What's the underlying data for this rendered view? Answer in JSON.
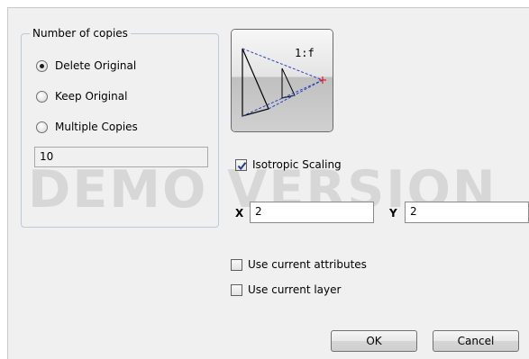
{
  "watermark": "DEMO VERSION",
  "copies_group": {
    "title": "Number of copies",
    "options": [
      {
        "label": "Delete Original",
        "selected": true
      },
      {
        "label": "Keep Original",
        "selected": false
      },
      {
        "label": "Multiple Copies",
        "selected": false
      }
    ],
    "count_value": "10"
  },
  "preview": {
    "ratio_label": "1:f",
    "icon": "scale-preview-icon"
  },
  "isotropic": {
    "label": "Isotropic Scaling",
    "checked": true
  },
  "scale": {
    "x_label": "X",
    "x_value": "2",
    "y_label": "Y",
    "y_value": "2"
  },
  "options": [
    {
      "label": "Use current attributes",
      "checked": false
    },
    {
      "label": "Use current layer",
      "checked": false
    }
  ],
  "buttons": {
    "ok": "OK",
    "cancel": "Cancel"
  },
  "colors": {
    "dialog_bg": "#f0f0f0",
    "accent_blue": "#2a3fbf",
    "marker_red": "#e0202a"
  }
}
